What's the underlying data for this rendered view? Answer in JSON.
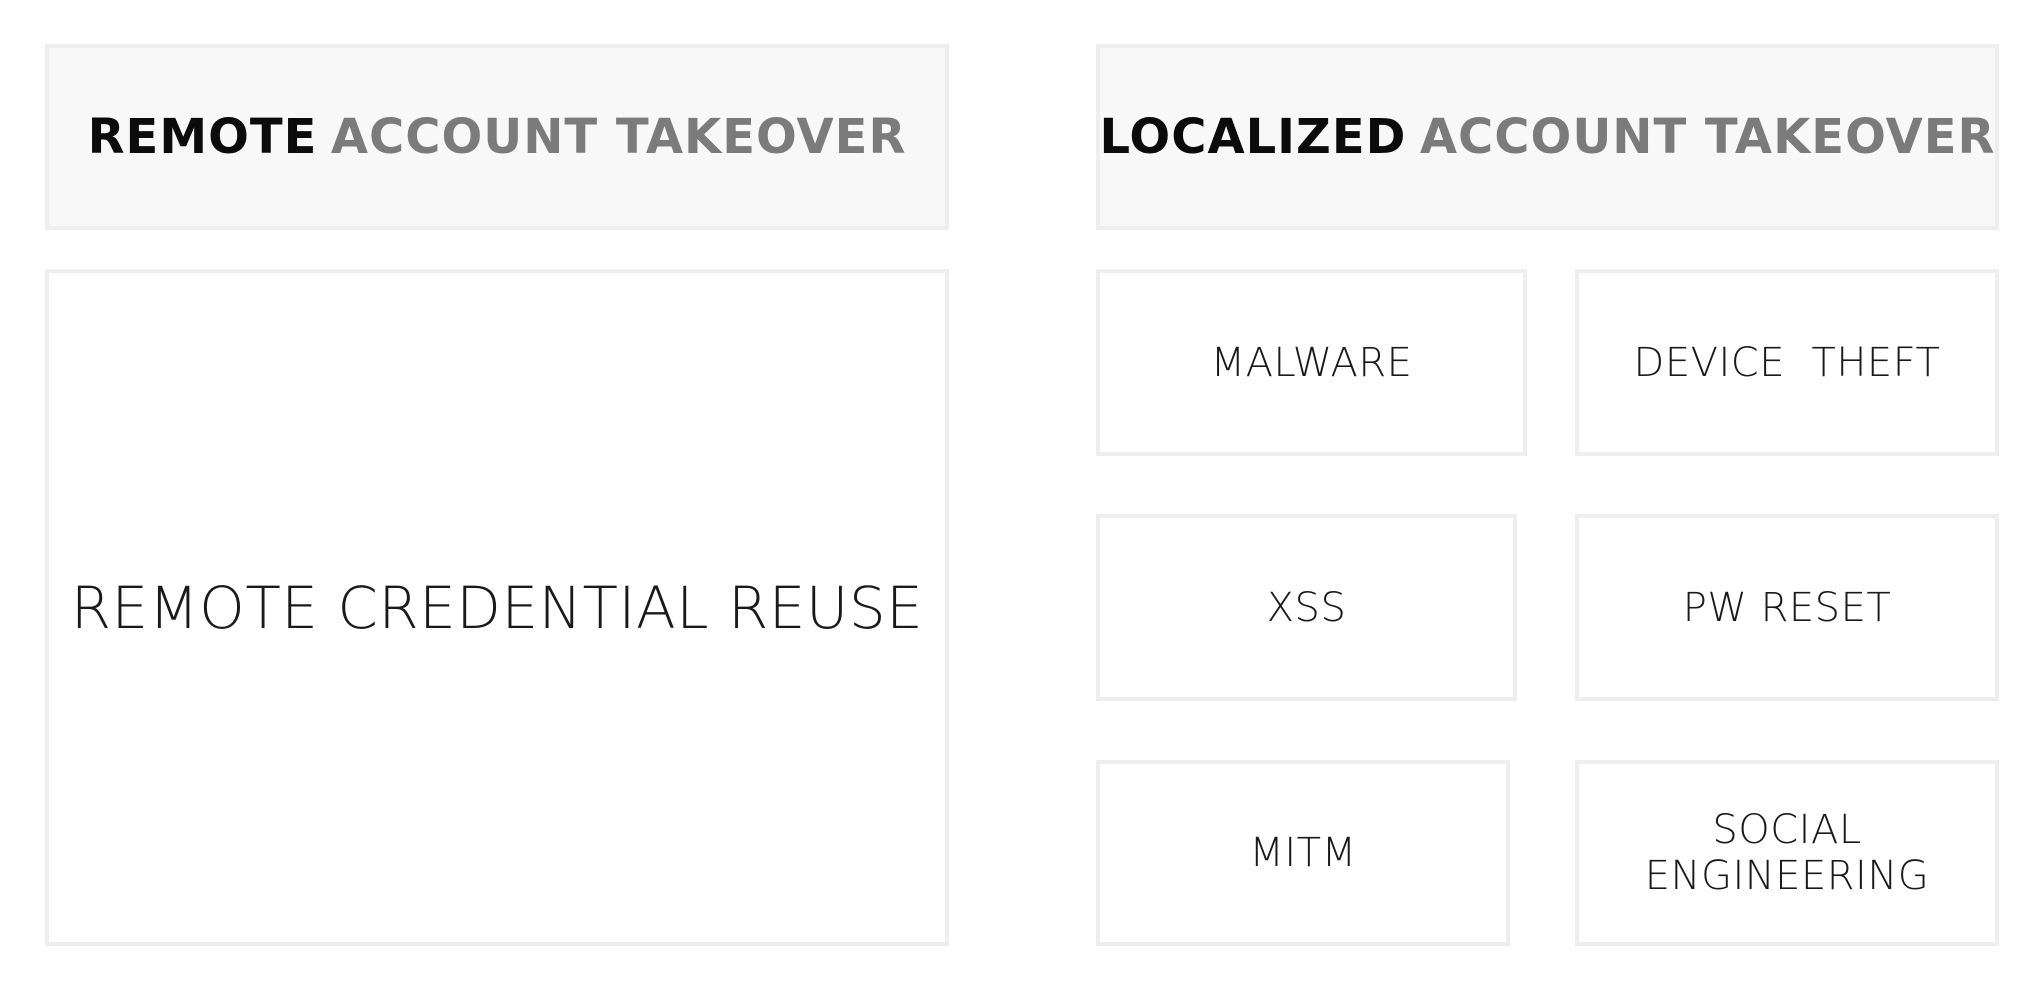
{
  "left_column": {
    "header_strong": "REMOTE",
    "header_muted": "ACCOUNT TAKEOVER",
    "body": "REMOTE CREDENTIAL REUSE"
  },
  "right_column": {
    "header_strong": "LOCALIZED",
    "header_muted": "ACCOUNT TAKEOVER",
    "items": {
      "malware": "MALWARE",
      "device_theft": "DEVICE  THEFT",
      "xss": "XSS",
      "pw_reset": "PW RESET",
      "mitm": "MITM",
      "social_engineering_line1": "SOCIAL",
      "social_engineering_line2": "ENGINEERING"
    }
  },
  "colors": {
    "border": "#eeeeee",
    "header_bg": "#f8f8f8",
    "strong_text": "#0b0b0b",
    "muted_text": "#7b7b7b"
  }
}
